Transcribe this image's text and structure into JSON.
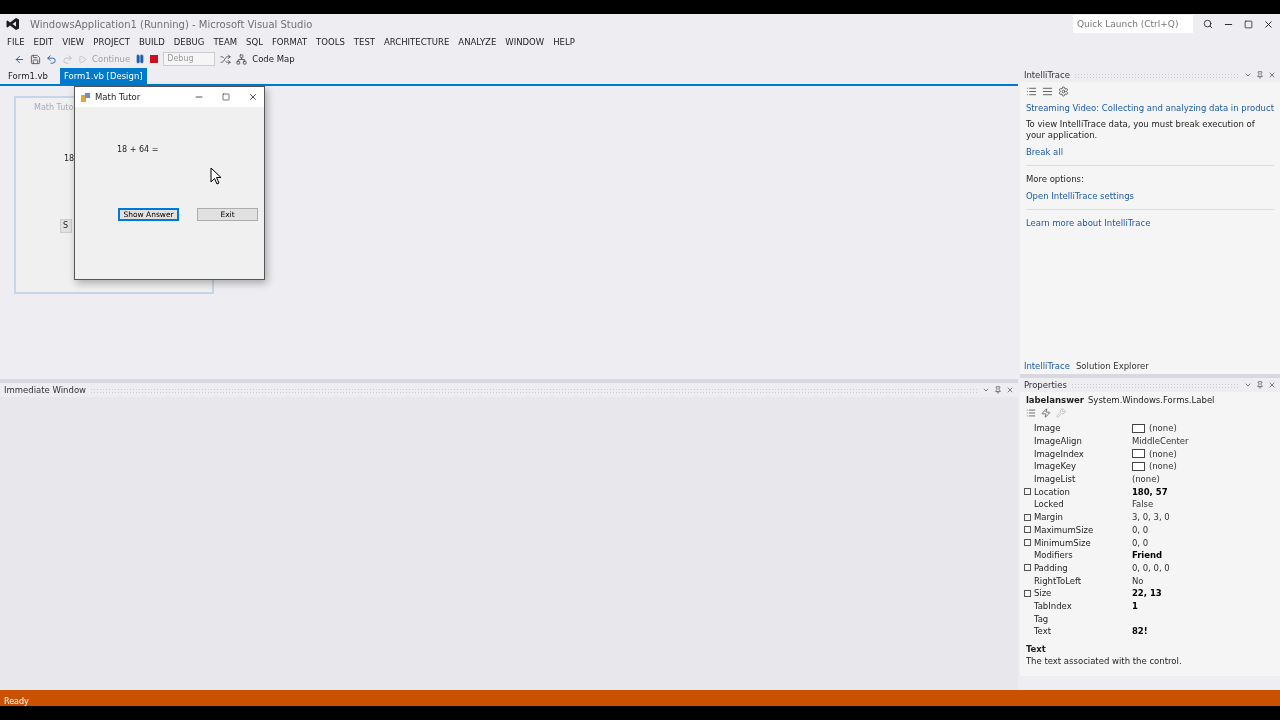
{
  "window": {
    "title": "WindowsApplication1 (Running) - Microsoft Visual Studio",
    "quick_launch": {
      "placeholder": "Quick Launch (Ctrl+Q)"
    }
  },
  "menu": [
    "FILE",
    "EDIT",
    "VIEW",
    "PROJECT",
    "BUILD",
    "DEBUG",
    "TEAM",
    "SQL",
    "FORMAT",
    "TOOLS",
    "TEST",
    "ARCHITECTURE",
    "ANALYZE",
    "WINDOW",
    "HELP"
  ],
  "toolbar": {
    "continue": "Continue",
    "configuration": "Debug",
    "code_map": "Code Map"
  },
  "doc_tabs": [
    {
      "label": "Form1.vb",
      "selected": false
    },
    {
      "label": "Form1.vb [Design]",
      "selected": true
    }
  ],
  "designer_form": {
    "title": "Math Tuto",
    "label": "18",
    "button": "S"
  },
  "running_form": {
    "title": "Math Tutor",
    "question": "18 + 64 =",
    "buttons": [
      {
        "label": "Show Answer",
        "selected": true
      },
      {
        "label": "Exit",
        "selected": false
      }
    ]
  },
  "intellitrace": {
    "title": "IntelliTrace",
    "video_link": "Streaming Video: Collecting and analyzing data in product",
    "message": "To view IntelliTrace data, you must break execution of your application.",
    "break_all": "Break all",
    "more_options": "More options:",
    "settings_link": "Open IntelliTrace settings",
    "learn_link": "Learn more about IntelliTrace",
    "tabs": [
      {
        "label": "IntelliTrace",
        "selected": true
      },
      {
        "label": "Solution Explorer",
        "selected": false
      }
    ]
  },
  "properties": {
    "title": "Properties",
    "object_name": "labelanswer",
    "object_type": "System.Windows.Forms.Label",
    "rows": [
      {
        "name": "Image",
        "value": "(none)",
        "expandable": false,
        "bold": false,
        "swatch": true
      },
      {
        "name": "ImageAlign",
        "value": "MiddleCenter",
        "expandable": false,
        "bold": false,
        "swatch": false
      },
      {
        "name": "ImageIndex",
        "value": "(none)",
        "expandable": false,
        "bold": false,
        "swatch": true
      },
      {
        "name": "ImageKey",
        "value": "(none)",
        "expandable": false,
        "bold": false,
        "swatch": true
      },
      {
        "name": "ImageList",
        "value": "(none)",
        "expandable": false,
        "bold": false,
        "swatch": false
      },
      {
        "name": "Location",
        "value": "180, 57",
        "expandable": true,
        "bold": true,
        "swatch": false
      },
      {
        "name": "Locked",
        "value": "False",
        "expandable": false,
        "bold": false,
        "swatch": false
      },
      {
        "name": "Margin",
        "value": "3, 0, 3, 0",
        "expandable": true,
        "bold": false,
        "swatch": false
      },
      {
        "name": "MaximumSize",
        "value": "0, 0",
        "expandable": true,
        "bold": false,
        "swatch": false
      },
      {
        "name": "MinimumSize",
        "value": "0, 0",
        "expandable": true,
        "bold": false,
        "swatch": false
      },
      {
        "name": "Modifiers",
        "value": "Friend",
        "expandable": false,
        "bold": true,
        "swatch": false
      },
      {
        "name": "Padding",
        "value": "0, 0, 0, 0",
        "expandable": true,
        "bold": false,
        "swatch": false
      },
      {
        "name": "RightToLeft",
        "value": "No",
        "expandable": false,
        "bold": false,
        "swatch": false
      },
      {
        "name": "Size",
        "value": "22, 13",
        "expandable": true,
        "bold": true,
        "swatch": false
      },
      {
        "name": "TabIndex",
        "value": "1",
        "expandable": false,
        "bold": true,
        "swatch": false
      },
      {
        "name": "Tag",
        "expandable": false,
        "swatch": false
      },
      {
        "name": "Text",
        "value": "82!",
        "expandable": false,
        "bold": true,
        "swatch": false
      }
    ],
    "description_title": "Text",
    "description": "The text associated with the control."
  },
  "immediate_window": {
    "title": "Immediate Window"
  },
  "status_bar": {
    "text": "Ready"
  }
}
